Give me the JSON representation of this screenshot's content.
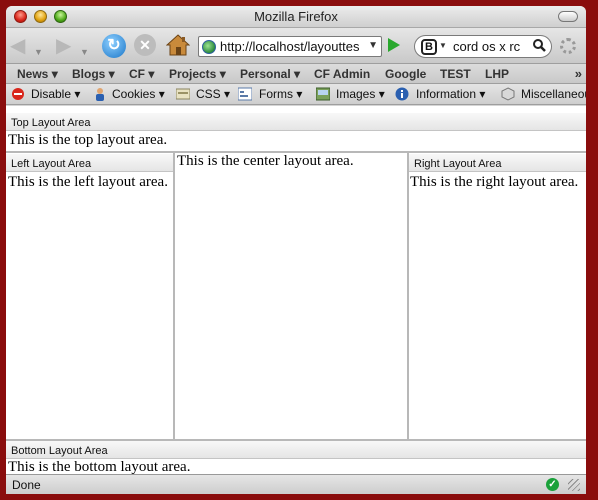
{
  "window": {
    "title": "Mozilla Firefox"
  },
  "nav": {
    "url": "http://localhost/layouttes",
    "search_value": "cord os x rc"
  },
  "bookmarks": {
    "items": [
      "News",
      "Blogs",
      "CF",
      "Projects",
      "Personal",
      "CF Admin",
      "Google",
      "TEST",
      "LHP"
    ],
    "more": "»"
  },
  "devbar": {
    "items": [
      "Disable",
      "Cookies",
      "CSS",
      "Forms",
      "Images",
      "Information",
      "Miscellaneous"
    ]
  },
  "page": {
    "top_header": "Top Layout Area",
    "top_text": "This is the top layout area.",
    "left_header": "Left Layout Area",
    "left_text": "This is the left layout area.",
    "center_text": "This is the center layout area.",
    "right_header": "Right Layout Area",
    "right_text": "This is the right layout area.",
    "bottom_header": "Bottom Layout Area",
    "bottom_text": "This is the bottom layout area."
  },
  "status": {
    "text": "Done"
  },
  "colors": {
    "desktop": "#8a0d0d",
    "go_arrow": "#2aa82e",
    "reload": "#1a76c8",
    "status_ok": "#1aa13a"
  }
}
